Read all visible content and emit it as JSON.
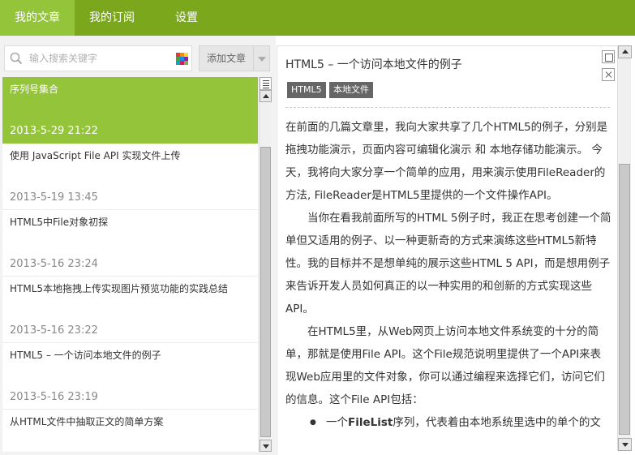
{
  "nav": {
    "tabs": [
      {
        "label": "我的文章",
        "active": true
      },
      {
        "label": "我的订阅",
        "active": false
      },
      {
        "label": "设置",
        "active": false
      }
    ]
  },
  "colors": {
    "nav_bar": "#7aa71b",
    "nav_active": "#94c43a",
    "selected_item": "#94c43a",
    "tag_bg": "#666666"
  },
  "toolbar": {
    "search_placeholder": "输入搜索关键字",
    "add_label": "添加文章"
  },
  "articles": [
    {
      "title": "序列号集合",
      "date": "2013-5-29 21:22",
      "selected": true
    },
    {
      "title": "使用 JavaScript File API 实现文件上传",
      "date": "2013-5-19 13:45",
      "selected": false
    },
    {
      "title": "HTML5中File对象初探",
      "date": "2013-5-16 23:24",
      "selected": false
    },
    {
      "title": "HTML5本地拖拽上传实现图片预览功能的实践总结",
      "date": "2013-5-16 23:22",
      "selected": false
    },
    {
      "title": "HTML5 – 一个访问本地文件的例子",
      "date": "2013-5-16 23:19",
      "selected": false
    },
    {
      "title": "从HTML文件中抽取正文的简单方案",
      "date": "",
      "selected": false
    }
  ],
  "article": {
    "title": "HTML5 – 一个访问本地文件的例子",
    "tags": [
      "HTML5",
      "本地文件"
    ],
    "paragraphs": [
      "在前面的几篇文章里，我向大家共享了几个HTML5的例子，分别是拖拽功能演示，页面内容可编辑化演示 和 本地存储功能演示。  今天，我将向大家分享一个简单的应用，用来演示使用FileReader的方法, FileReader是HTML5里提供的一个文件操作API。",
      "当你在看我前面所写的HTML 5例子时，我正在思考创建一个简单但又适用的例子、以一种更新奇的方式来演练这些HTML5新特性。我的目标并不是想单纯的展示这些HTML 5 API，而是想用例子来告诉开发人员如何真正的以一种实用的和创新的方式实现这些API。",
      "在HTML5里，从Web网页上访问本地文件系统变的十分的简单，那就是使用File API。这个File规范说明里提供了一个API来表现Web应用里的文件对象，你可以通过编程来选择它们，访问它们的信息。这个File API包括："
    ],
    "bullets": [
      {
        "bold": "FileList",
        "rest": "序列，代表着由本地系统里选中的单个的文"
      }
    ]
  },
  "icons": {
    "search": "search-icon",
    "color": "color-grid-icon",
    "list_menu": "list-menu-icon",
    "maximize": "maximize-icon",
    "close": "close-icon"
  }
}
